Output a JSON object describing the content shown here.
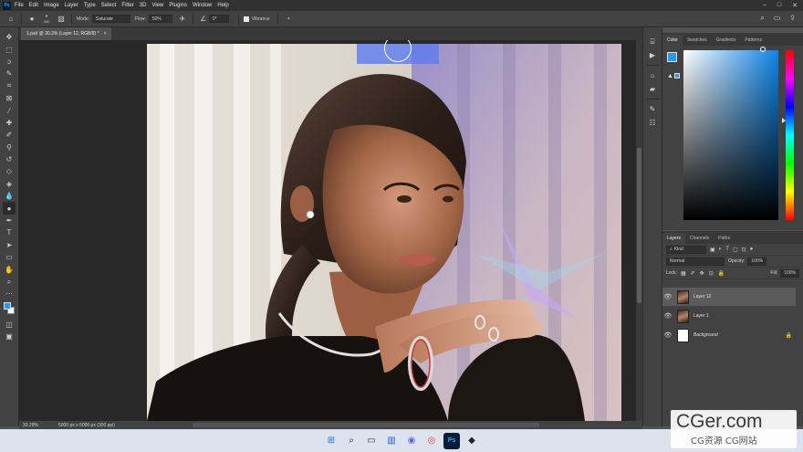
{
  "app": {
    "logo": "Ps"
  },
  "menu": [
    "File",
    "Edit",
    "Image",
    "Layer",
    "Type",
    "Select",
    "Filter",
    "3D",
    "View",
    "Plugins",
    "Window",
    "Help"
  ],
  "window_controls": [
    "–",
    "□",
    "✕"
  ],
  "options": {
    "brush_size": "400",
    "mode_label": "Mode:",
    "mode_value": "Saturate",
    "flow_label": "Flow:",
    "flow_value": "50%",
    "angle_value": "0°",
    "vibrance_label": "Vibrance"
  },
  "document": {
    "tab_title": "1.psd @ 30.3% (Layer 12, RGB/8) *",
    "close": "×"
  },
  "status": {
    "zoom": "30.29%",
    "size": "5000 px x 6000 px (300 ppi)"
  },
  "color_panel": {
    "tabs": [
      "Color",
      "Swatches",
      "Gradients",
      "Patterns"
    ],
    "foreground": "#2a9af0",
    "background": "#ffffff",
    "hue_base": "#0d84e8"
  },
  "layers_panel": {
    "tabs": [
      "Layers",
      "Channels",
      "Paths"
    ],
    "filter_kind": "Kind",
    "blend_mode": "Normal",
    "opacity_label": "Opacity:",
    "opacity_value": "100%",
    "lock_label": "Lock:",
    "fill_label": "Fill:",
    "fill_value": "100%",
    "layers": [
      {
        "name": "Layer 12",
        "visible": true,
        "selected": true
      },
      {
        "name": "Layer 1",
        "visible": true,
        "selected": false
      },
      {
        "name": "Background",
        "visible": true,
        "selected": false,
        "locked": true
      }
    ]
  },
  "watermark": {
    "main": "CGer.com",
    "sub": "CG资源 CG网站"
  }
}
